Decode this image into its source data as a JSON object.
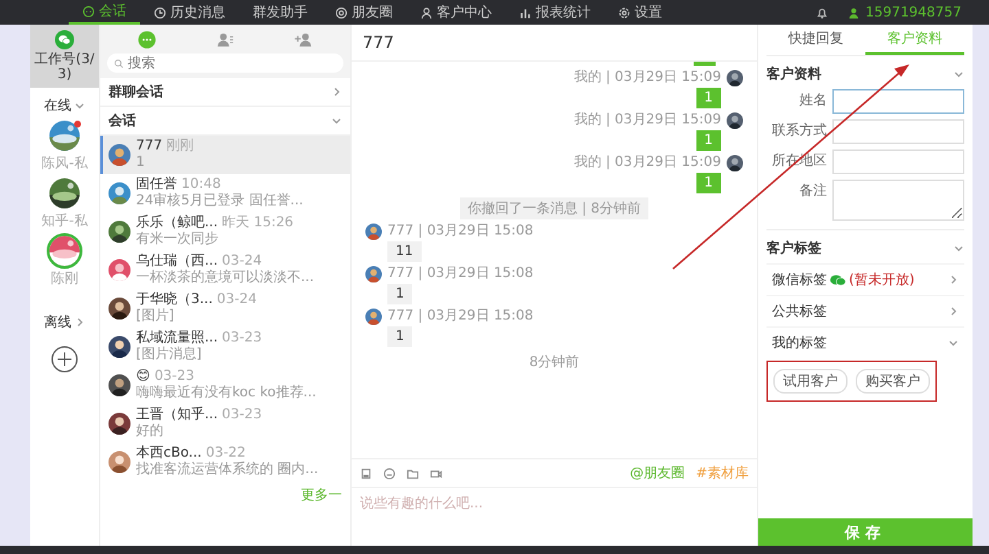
{
  "nav": {
    "items": [
      {
        "label": "会话",
        "selected": true
      },
      {
        "label": "历史消息",
        "selected": false
      },
      {
        "label": "群发助手",
        "selected": false
      },
      {
        "label": "朋友圈",
        "selected": false
      },
      {
        "label": "客户中心",
        "selected": false
      },
      {
        "label": "报表统计",
        "selected": false
      },
      {
        "label": "设置",
        "selected": false
      }
    ],
    "phone": "15971948757"
  },
  "accounts": {
    "title": "工作号(3/3)",
    "online": {
      "label": "在线",
      "expanded": true
    },
    "items": [
      {
        "label": "陈风-私",
        "unread": true
      },
      {
        "label": "知乎-私",
        "unread": false
      },
      {
        "label": "陈刚",
        "unread": false
      }
    ],
    "offline": {
      "label": "离线",
      "expanded": false
    }
  },
  "contacts": {
    "tabs": [
      {
        "selected": true
      },
      {
        "selected": false
      },
      {
        "selected": false
      }
    ],
    "search": {
      "placeholder": "搜索"
    },
    "groups": {
      "label": "群聊会话",
      "expanded": false
    },
    "sessions": {
      "label": "会话",
      "expanded": true
    },
    "items": [
      {
        "name": "777",
        "time": "刚刚",
        "preview": "1",
        "selected": true
      },
      {
        "name": "固任誉",
        "time": "10:48",
        "preview": "24审核5月已登录 固任誉...",
        "selected": false
      },
      {
        "name": "乐乐（鲸吧...",
        "time": "昨天 15:26",
        "preview": "有米一次同步",
        "selected": false
      },
      {
        "name": "乌仕瑞（西...",
        "time": "03-24",
        "preview": "一杯淡茶的意境可以淡淡不...",
        "selected": false
      },
      {
        "name": "于华晓（3...",
        "time": "03-24",
        "preview": "[图片]",
        "selected": false
      },
      {
        "name": "私域流量照...",
        "time": "03-23",
        "preview": "[图片消息]",
        "selected": false
      },
      {
        "name": "😊",
        "time": "03-23",
        "preview": "嗨嗨最近有没有koc ko推荐...",
        "selected": false
      },
      {
        "name": "王晋（知乎...",
        "time": "03-23",
        "preview": "好的",
        "selected": false
      },
      {
        "name": "本西cBo...",
        "time": "03-22",
        "preview": "找准客流运营体系统的 圈内...",
        "selected": false
      }
    ],
    "more": "更多一"
  },
  "chat": {
    "title": "777",
    "messages": [
      {
        "kind": "sent",
        "meta": "我的 | 03月29日 15:09",
        "text": "1"
      },
      {
        "kind": "sent",
        "meta": "我的 | 03月29日 15:09",
        "text": "1"
      },
      {
        "kind": "sent",
        "meta": "我的 | 03月29日 15:09",
        "text": "1"
      },
      {
        "kind": "system",
        "text": "你撤回了一条消息 | 8分钟前"
      },
      {
        "kind": "received",
        "meta": "777 | 03月29日 15:08",
        "text": "11"
      },
      {
        "kind": "received",
        "meta": "777 | 03月29日 15:08",
        "text": "1"
      },
      {
        "kind": "received",
        "meta": "777 | 03月29日 15:08",
        "text": "1"
      },
      {
        "kind": "system",
        "text": "8分钟前"
      }
    ],
    "links": [
      {
        "label": "@朋友圈",
        "color": "#5cb82e"
      },
      {
        "label": "#素材库",
        "color": "#f0a040"
      }
    ],
    "input": {
      "placeholder": "说些有趣的什么吧..."
    }
  },
  "profile": {
    "tabs": [
      {
        "label": "快捷回复",
        "selected": false
      },
      {
        "label": "客户资料",
        "selected": true
      }
    ],
    "info": {
      "title": "客户资料",
      "expanded": true
    },
    "fields": [
      {
        "label": "姓名",
        "kind": "input",
        "focused": true
      },
      {
        "label": "联系方式",
        "kind": "input",
        "focused": false
      },
      {
        "label": "所在地区",
        "kind": "input",
        "focused": false
      },
      {
        "label": "备注",
        "kind": "textarea",
        "focused": false
      }
    ],
    "tag_section": {
      "title": "客户标签",
      "expanded": true
    },
    "tag_groups": [
      {
        "label": "微信标签",
        "note": "(暂未开放)",
        "expanded": false
      },
      {
        "label": "公共标签",
        "expanded": false
      },
      {
        "label": "我的标签",
        "expanded": true
      }
    ],
    "tags": [
      "试用客户",
      "购买客户"
    ],
    "save": "保存"
  }
}
